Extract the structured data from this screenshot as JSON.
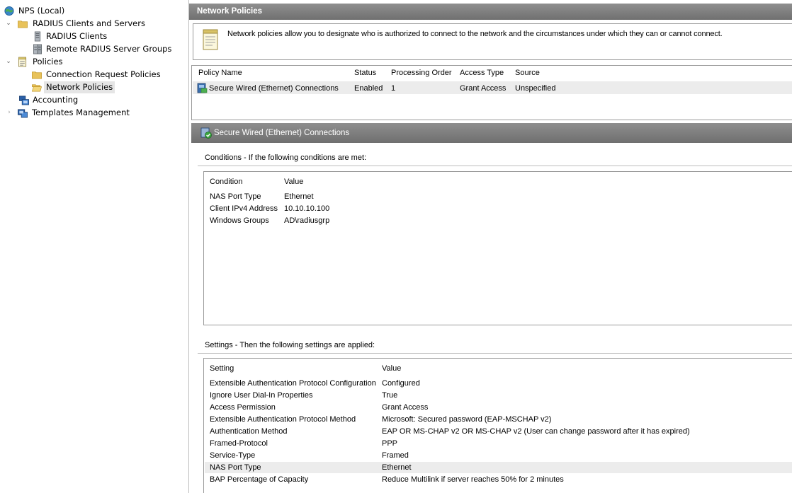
{
  "tree": {
    "root": "NPS (Local)",
    "radius_group": "RADIUS Clients and Servers",
    "radius_clients": "RADIUS Clients",
    "remote_groups": "Remote RADIUS Server Groups",
    "policies": "Policies",
    "connection_request": "Connection Request Policies",
    "network_policies": "Network Policies",
    "accounting": "Accounting",
    "templates": "Templates Management"
  },
  "panel": {
    "title": "Network Policies",
    "description": "Network policies allow you to designate who is authorized to connect to the network and the circumstances under which they can or cannot connect."
  },
  "policy_table": {
    "columns": [
      "Policy Name",
      "Status",
      "Processing Order",
      "Access Type",
      "Source"
    ],
    "rows": [
      [
        "Secure Wired (Ethernet) Connections",
        "Enabled",
        "1",
        "Grant Access",
        "Unspecified"
      ]
    ]
  },
  "detail": {
    "title": "Secure Wired (Ethernet) Connections",
    "conditions_label": "Conditions - If the following conditions are met:",
    "conditions_columns": [
      "Condition",
      "Value"
    ],
    "conditions": [
      [
        "NAS Port Type",
        "Ethernet"
      ],
      [
        "Client IPv4 Address",
        "10.10.10.100"
      ],
      [
        "Windows Groups",
        "AD\\radiusgrp"
      ]
    ],
    "settings_label": "Settings - Then the following settings are applied:",
    "settings_columns": [
      "Setting",
      "Value"
    ],
    "settings": [
      [
        "Extensible Authentication Protocol Configuration",
        "Configured"
      ],
      [
        "Ignore User Dial-In Properties",
        "True"
      ],
      [
        "Access Permission",
        "Grant Access"
      ],
      [
        "Extensible Authentication Protocol Method",
        "Microsoft: Secured password (EAP-MSCHAP v2)"
      ],
      [
        "Authentication Method",
        "EAP OR MS-CHAP v2 OR MS-CHAP v2 (User can change password after it has expired)"
      ],
      [
        "Framed-Protocol",
        "PPP"
      ],
      [
        "Service-Type",
        "Framed"
      ],
      [
        "NAS Port Type",
        "Ethernet"
      ],
      [
        "BAP Percentage of Capacity",
        "Reduce Multilink if server reaches 50% for 2 minutes"
      ]
    ]
  },
  "icons": {
    "root": "globe-server-icon",
    "folder": "folder-icon",
    "server": "server-icon",
    "server_group": "server-group-icon",
    "policies": "document-icon",
    "accounting": "accounting-icon",
    "templates": "templates-icon",
    "policy_row": "policy-icon",
    "detail": "policy-check-icon",
    "description": "notepad-icon"
  }
}
